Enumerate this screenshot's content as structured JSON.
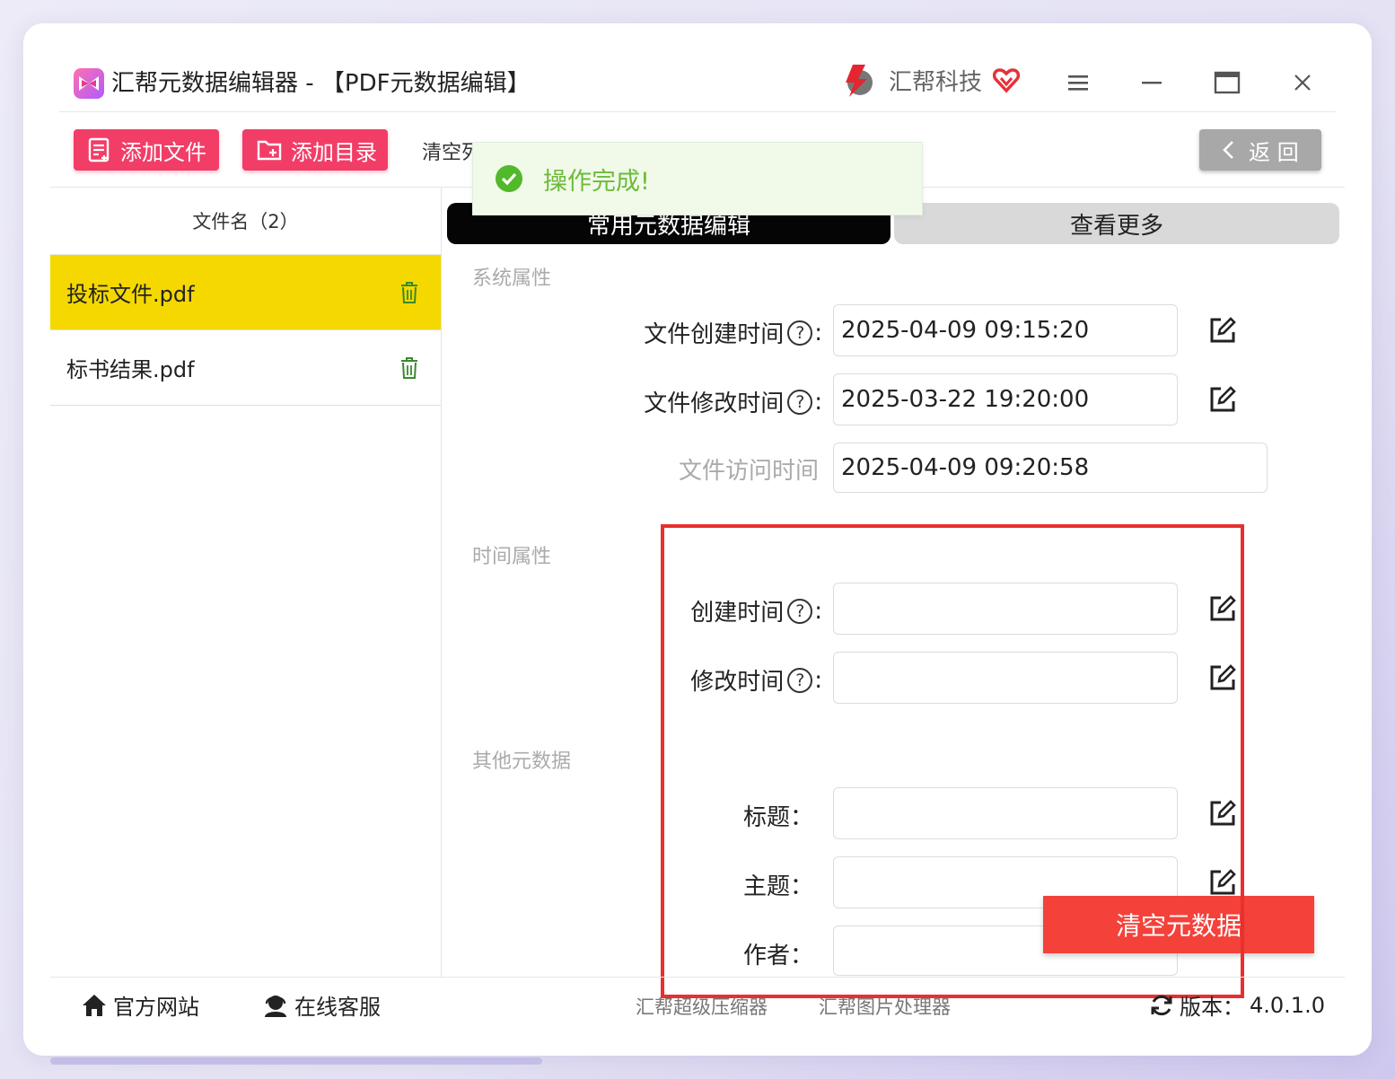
{
  "app": {
    "title": "汇帮元数据编辑器 - 【PDF元数据编辑】",
    "brand_name": "汇帮科技",
    "accent_pink": "#f23d67",
    "highlight_yellow": "#f4d800",
    "alert_red": "#f4413a"
  },
  "toolbar": {
    "add_file_label": "添加文件",
    "add_dir_label": "添加目录",
    "clear_list_label": "清空列表",
    "back_label": "返 回"
  },
  "toast": {
    "message": "操作完成!"
  },
  "file_list": {
    "header": "文件名（2）",
    "items": [
      {
        "name": "投标文件.pdf",
        "selected": true
      },
      {
        "name": "标书结果.pdf",
        "selected": false
      }
    ]
  },
  "tabs": {
    "active": "常用元数据编辑",
    "more": "查看更多"
  },
  "sections": {
    "system": "系统属性",
    "time": "时间属性",
    "other": "其他元数据"
  },
  "fields": {
    "file_created": {
      "label": "文件创建时间",
      "value": "2025-04-09 09:15:20"
    },
    "file_modified": {
      "label": "文件修改时间",
      "value": "2025-03-22 19:20:00"
    },
    "file_accessed": {
      "label": "文件访问时间",
      "value": "2025-04-09 09:20:58"
    },
    "created": {
      "label": "创建时间",
      "value": ""
    },
    "modified": {
      "label": "修改时间",
      "value": ""
    },
    "title": {
      "label": "标题：",
      "value": ""
    },
    "subject": {
      "label": "主题：",
      "value": ""
    },
    "author": {
      "label": "作者：",
      "value": ""
    }
  },
  "actions": {
    "clear_metadata": "清空元数据"
  },
  "footer": {
    "website": "官方网站",
    "support": "在线客服",
    "link_compressor": "汇帮超级压缩器",
    "link_image": "汇帮图片处理器",
    "version_label": "版本：",
    "version": "4.0.1.0"
  }
}
